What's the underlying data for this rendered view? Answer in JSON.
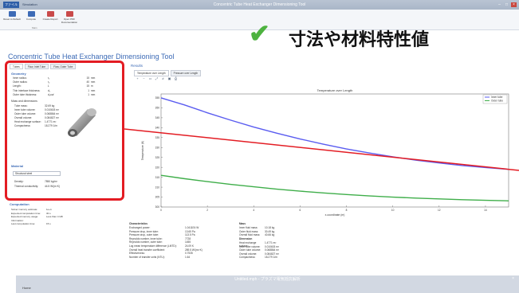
{
  "window": {
    "title": "Concentric Tube Heat Exchanger Dimensioning Tool",
    "file_tab": "ファイル",
    "doc_tab": "Simulation"
  },
  "ribbon": {
    "buttons": [
      {
        "label": "Reset to Default",
        "icon": "reset-icon",
        "color": "#3d6bb6"
      },
      {
        "label": "Compute",
        "icon": "compute-icon",
        "color": "#3d6bb6"
      },
      {
        "label": "Create Report",
        "icon": "report-icon",
        "color": "#c94a4a"
      },
      {
        "label": "Open PDF Documentation",
        "icon": "pdf-icon",
        "color": "#c94a4a"
      }
    ],
    "group_label": "Main"
  },
  "app_title": "Concentric Tube Heat Exchanger Dimensioning Tool",
  "overlay_text": "寸法や材料特性値",
  "left_panel": {
    "tabs": [
      "Tubes",
      "Flow, Inlet Tube",
      "Flow, Outer Tube"
    ],
    "geometry_head": "Geometry",
    "geometry_rows": [
      {
        "k": "Inner radius:",
        "s": "r₁",
        "v": "15",
        "u": "mm"
      },
      {
        "k": "Outer radius:",
        "s": "r₂",
        "v": "40",
        "u": "mm"
      },
      {
        "k": "Length:",
        "s": "L",
        "v": "15",
        "u": "m"
      },
      {
        "k": "Thin interface thickness:",
        "s": "d₁",
        "v": "1",
        "u": "mm"
      },
      {
        "k": "Outer tube thickness:",
        "s": "d₂out",
        "v": "1",
        "u": "mm"
      }
    ],
    "mass_head": "Mass and dimensions",
    "mass_rows": [
      {
        "k": "Tube mass:",
        "v": "32.69 kg"
      },
      {
        "k": "Inner tube volume:",
        "v": "0.010603 m³"
      },
      {
        "k": "Outer tube volume:",
        "v": "0.068864 m³"
      },
      {
        "k": "Overall volume:",
        "v": "0.084827 m³"
      },
      {
        "k": "Heat exchange surface:",
        "v": "1.4771 m²"
      },
      {
        "k": "Compactness:",
        "v": "18.279 1/m"
      }
    ],
    "material_head": "Material",
    "material_select": "Structural steel",
    "material_rows": [
      {
        "k": "Density:",
        "v": "7850 kg/m³"
      },
      {
        "k": "Thermal conductivity:",
        "v": "44.5 W/(m·K)"
      }
    ],
    "computation_head": "Computation",
    "computation_rows": [
      {
        "k": "Solver memory estimate:",
        "v": "1e+1"
      },
      {
        "k": "Expected computation time:",
        "v": "30 s"
      },
      {
        "k": "Expected memory usage:",
        "v": "Less than 4 GB"
      },
      {
        "k": "Information:",
        "v": ""
      },
      {
        "k": "Last computation time:",
        "v": "15 s"
      }
    ]
  },
  "results": {
    "head": "Results",
    "tabs": [
      "Temperature over Length",
      "Pressure over Length"
    ],
    "plot_title": "Temperature over Length",
    "ylabel": "Temperature (K)",
    "xlabel": "x-coordinate (m)",
    "legend": [
      "Inner tube",
      "Outer tube"
    ]
  },
  "chart_data": {
    "type": "line",
    "title": "Temperature over Length",
    "xlabel": "x-coordinate (m)",
    "ylabel": "Temperature (K)",
    "x": [
      0,
      1,
      2,
      3,
      4,
      5,
      6,
      7,
      8,
      9,
      10,
      11,
      12,
      13,
      14,
      15
    ],
    "xticks": [
      0,
      2,
      4,
      6,
      8,
      10,
      12,
      14
    ],
    "yticks": [
      300,
      305,
      310,
      315,
      320,
      325,
      330,
      335,
      340,
      345,
      350,
      355
    ],
    "ylim": [
      300,
      357
    ],
    "series": [
      {
        "name": "Inner tube",
        "color": "#5a5cf0",
        "values": [
          355,
          351.5,
          347.5,
          343.8,
          340.3,
          337.2,
          334.3,
          331.7,
          329.3,
          327.2,
          325.3,
          323.6,
          322.2,
          320.9,
          319.9,
          319
        ]
      },
      {
        "name": "Outer tube",
        "color": "#3fae4a",
        "values": [
          316,
          314.3,
          312.8,
          311.4,
          310.2,
          309,
          308,
          307.1,
          306.3,
          305.6,
          305,
          304.5,
          304.1,
          303.7,
          303.4,
          303.1
        ]
      }
    ],
    "legend_position": "top-right",
    "grid": false
  },
  "summary": {
    "char_head": "Characteristics",
    "char_rows": [
      {
        "k": "Exchanged power:",
        "v": "1.0411E4 W"
      },
      {
        "k": "Pressure drop, inner tube:",
        "v": "13.65 Pa"
      },
      {
        "k": "Pressure drop, outer tube:",
        "v": "113.5 Pa"
      },
      {
        "k": "Reynolds number, inner tube:",
        "v": "7728"
      },
      {
        "k": "Reynolds number, outer tube:",
        "v": "1455"
      },
      {
        "k": "Log mean temperature difference (LMTD):",
        "v": "24.09 K"
      },
      {
        "k": "Overall heat transfer coefficient:",
        "v": "289.5 W/(m²·K)"
      },
      {
        "k": "Effectiveness:",
        "v": "0.7535"
      },
      {
        "k": "Number of transfer units (NTU):",
        "v": "1.64"
      }
    ],
    "mass_head": "Mass",
    "mass_rows": [
      {
        "k": "Inner fluid mass:",
        "v": "10.18 kg"
      },
      {
        "k": "Outer fluid mass:",
        "v": "30.49 kg"
      },
      {
        "k": "Overall fluid mass:",
        "v": "40.66 kg"
      }
    ],
    "dim_head": "Dimension",
    "dim_rows": [
      {
        "k": "Heat exchange surface:",
        "v": "1.4771 m²"
      },
      {
        "k": "Inner tube volume:",
        "v": "0.010603 m³"
      },
      {
        "k": "Outer tube volume:",
        "v": "0.068864 m³"
      },
      {
        "k": "Overall volume:",
        "v": "0.084827 m³"
      },
      {
        "k": "Compactness:",
        "v": "18.279 1/m"
      }
    ]
  },
  "taskwin": {
    "title": "Untitled.mph - プラズマ電気抵抗解析",
    "menu": "Home"
  }
}
